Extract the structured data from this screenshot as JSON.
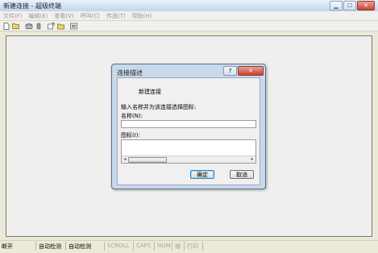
{
  "window": {
    "title": "新建连接 - 超级终端",
    "caption": {
      "minimize": "▁",
      "maximize": "☐",
      "close": "✕"
    }
  },
  "menu": [
    "文件(F)",
    "编辑(E)",
    "查看(V)",
    "呼叫(C)",
    "传送(T)",
    "帮助(H)"
  ],
  "toolbar": {
    "icons": [
      "new-document-icon",
      "open-folder-icon",
      "dial-phone-icon",
      "disconnect-icon",
      "send-file-icon",
      "receive-file-icon",
      "properties-icon"
    ]
  },
  "statusbar": {
    "connection": "断开",
    "auto_detect_1": "自动检测",
    "auto_detect_2": "自动检测",
    "scroll": "SCROLL",
    "caps": "CAPS",
    "num": "NUM",
    "capture": "捕",
    "print": "打印"
  },
  "dialog": {
    "title": "连接描述",
    "help_label": "?",
    "close_label": "✕",
    "connection_name": "新建连接",
    "instruction": "输入名称并为该连接选择图标:",
    "name_label": "名称(N):",
    "name_value": "",
    "icon_label": "图标(I):",
    "ok_label": "确定",
    "cancel_label": "取消"
  },
  "colors": {
    "accent": "#3c7fb1",
    "close_red": "#c7402a",
    "dialog_frame": "#c9d9ea"
  }
}
